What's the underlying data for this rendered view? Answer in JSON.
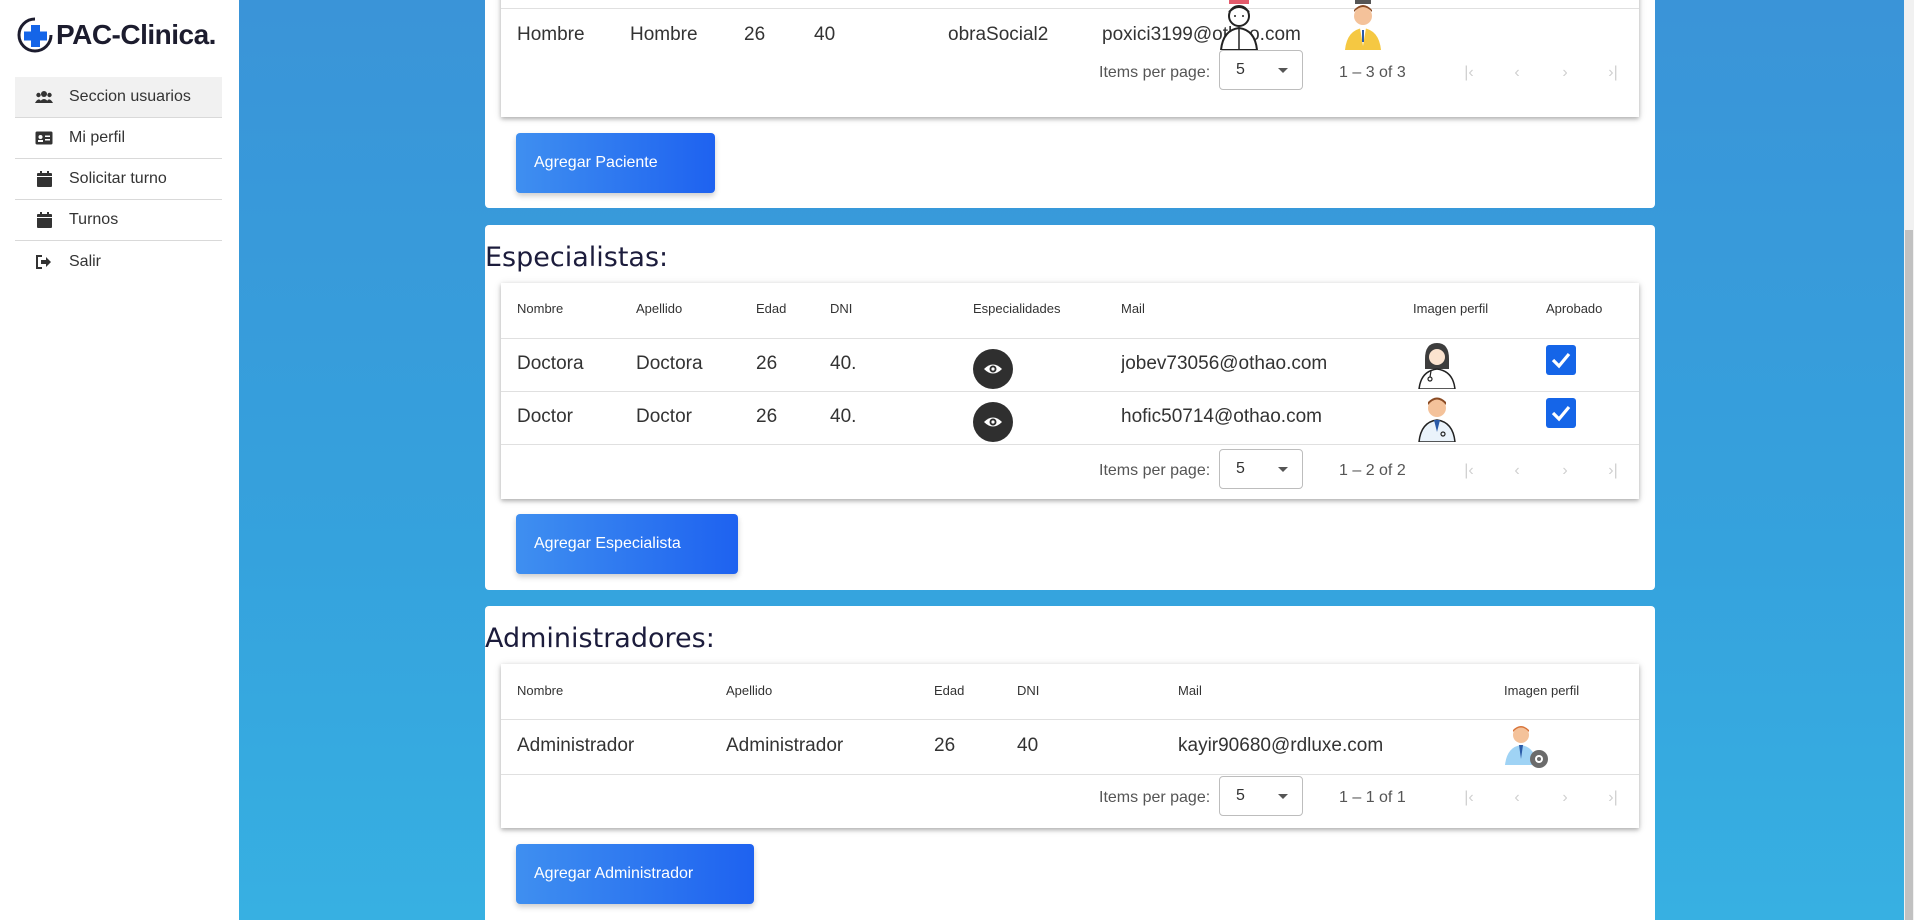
{
  "brand": {
    "name": "PAC-Clinica."
  },
  "sidebar": {
    "items": [
      {
        "label": "Seccion usuarios",
        "icon": "users-icon",
        "active": true
      },
      {
        "label": "Mi perfil",
        "icon": "id-card-icon",
        "active": false
      },
      {
        "label": "Solicitar turno",
        "icon": "calendar-icon",
        "active": false
      },
      {
        "label": "Turnos",
        "icon": "calendar-icon",
        "active": false
      },
      {
        "label": "Salir",
        "icon": "sign-out-icon",
        "active": false
      }
    ]
  },
  "pacientes": {
    "visible_row": {
      "nombre": "Hombre",
      "apellido": "Hombre",
      "edad": "26",
      "dni": "40",
      "obra_social": "obraSocial2",
      "mail": "poxici3199@othao.com"
    },
    "pager": {
      "items_label": "Items per page:",
      "page_size": "5",
      "range": "1 – 3 of 3"
    },
    "add_button": "Agregar Paciente"
  },
  "especialistas": {
    "title": "Especialistas:",
    "headers": [
      "Nombre",
      "Apellido",
      "Edad",
      "DNI",
      "Especialidades",
      "Mail",
      "Imagen perfil",
      "Aprobado"
    ],
    "rows": [
      {
        "nombre": "Doctora",
        "apellido": "Doctora",
        "edad": "26",
        "dni": "40...",
        "mail": "jobev73056@othao.com",
        "aprobado": true
      },
      {
        "nombre": "Doctor",
        "apellido": "Doctor",
        "edad": "26",
        "dni": "40...",
        "mail": "hofic50714@othao.com",
        "aprobado": true
      }
    ],
    "pager": {
      "items_label": "Items per page:",
      "page_size": "5",
      "range": "1 – 2 of 2"
    },
    "add_button": "Agregar Especialista"
  },
  "administradores": {
    "title": "Administradores:",
    "headers": [
      "Nombre",
      "Apellido",
      "Edad",
      "DNI",
      "Mail",
      "Imagen perfil"
    ],
    "rows": [
      {
        "nombre": "Administrador",
        "apellido": "Administrador",
        "edad": "26",
        "dni": "40",
        "mail": "kayir90680@rdluxe.com"
      }
    ],
    "pager": {
      "items_label": "Items per page:",
      "page_size": "5",
      "range": "1 – 1 of 1"
    },
    "add_button": "Agregar Administrador"
  },
  "pager_icons": [
    "first-page-icon",
    "prev-page-icon",
    "next-page-icon",
    "last-page-icon"
  ],
  "colors": {
    "background": "#3a94d8",
    "button": "#1e62f0",
    "checkbox": "#1565e8",
    "title": "#1c1c3c"
  }
}
